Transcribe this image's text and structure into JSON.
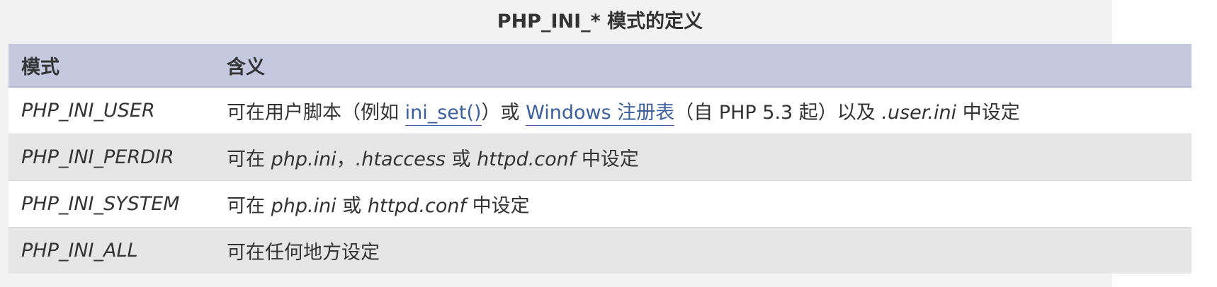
{
  "table": {
    "caption": "PHP_INI_* 模式的定义",
    "headers": {
      "mode": "模式",
      "meaning": "含义"
    },
    "rows": [
      {
        "mode": "PHP_INI_USER",
        "meaning": {
          "p1": "可在用户脚本（例如",
          "link1": "ini_set()",
          "p2": "）或",
          "link2": "Windows 注册表",
          "p3": "（自 PHP 5.3 起）以及",
          "em1": ".user.ini",
          "p4": "中设定"
        }
      },
      {
        "mode": "PHP_INI_PERDIR",
        "meaning": {
          "p1": "可在",
          "em1": "php.ini",
          "p2": "，",
          "em2": ".htaccess",
          "p3": "或",
          "em3": "httpd.conf",
          "p4": "中设定"
        }
      },
      {
        "mode": "PHP_INI_SYSTEM",
        "meaning": {
          "p1": "可在",
          "em1": "php.ini",
          "p2": "或",
          "em2": "httpd.conf",
          "p3": "中设定"
        }
      },
      {
        "mode": "PHP_INI_ALL",
        "meaning": {
          "p1": "可在任何地方设定"
        }
      }
    ]
  },
  "colors": {
    "header_bg": "#c4c9df",
    "row_odd_bg": "#ffffff",
    "row_even_bg": "#e6e6e6",
    "page_bg": "#f2f2f2",
    "link": "#3a5f9c",
    "text": "#333333"
  }
}
